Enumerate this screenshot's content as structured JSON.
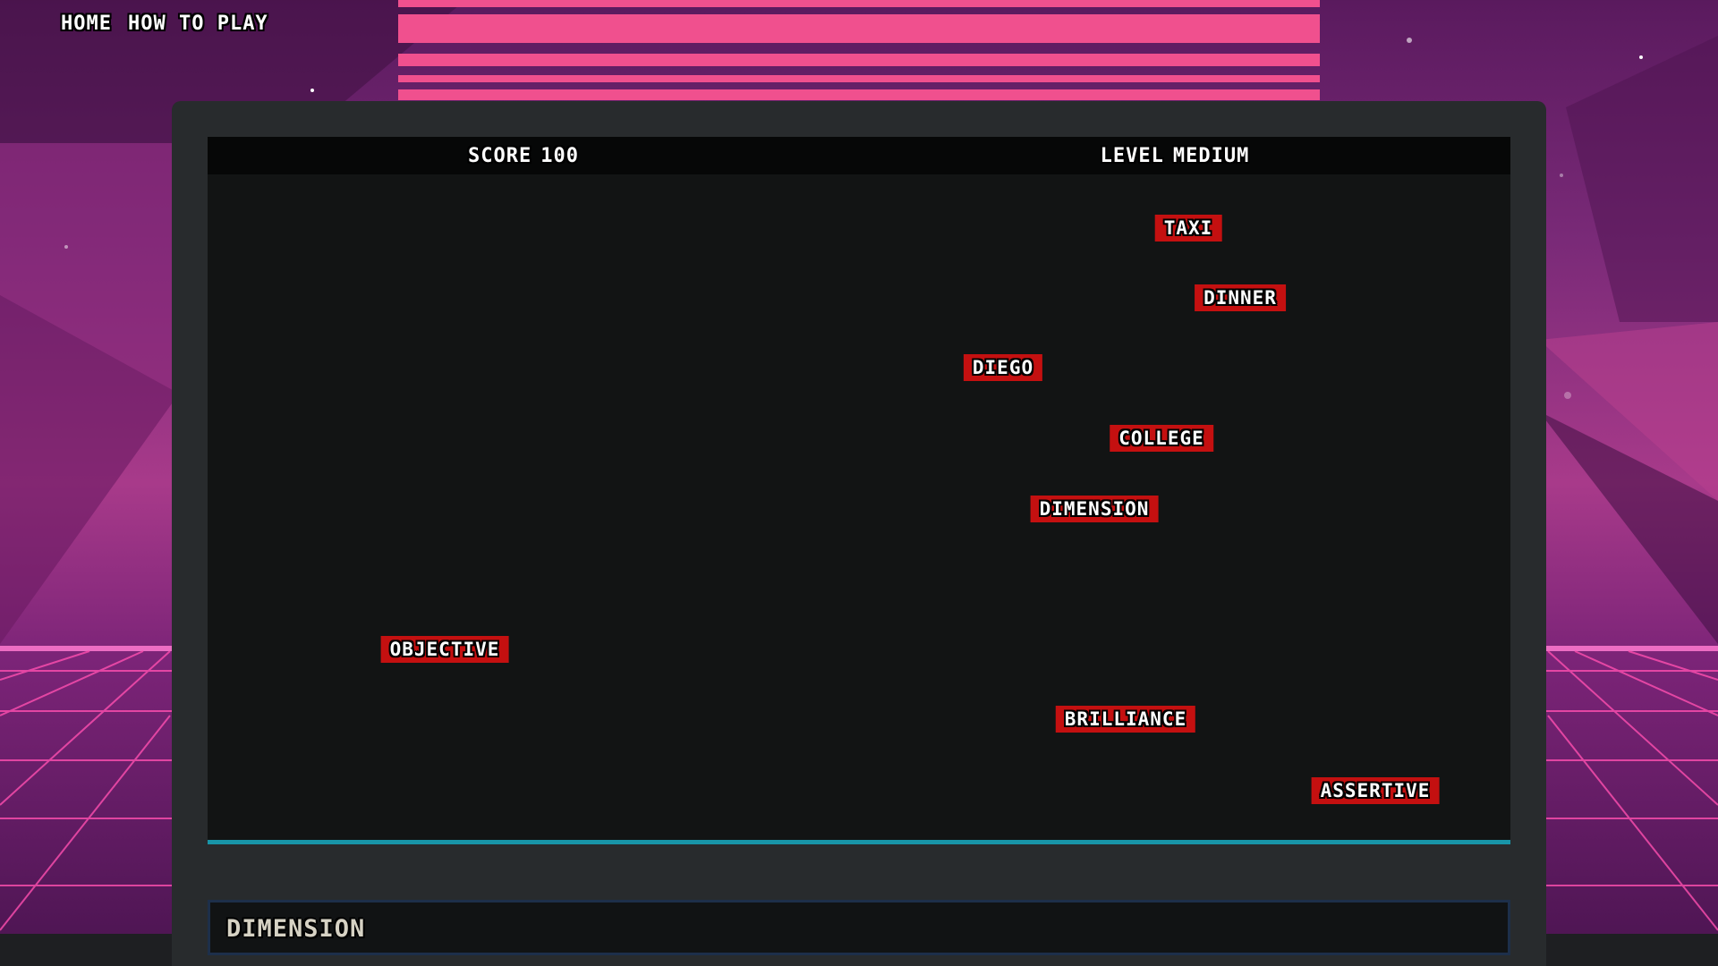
{
  "nav": {
    "home_label": "HOME",
    "how_to_play_label": "HOW TO PLAY"
  },
  "hud": {
    "score_label": "SCORE",
    "score_value": "100",
    "level_label": "LEVEL",
    "level_value": "MEDIUM"
  },
  "words": [
    "TAXI",
    "DINNER",
    "DIEGO",
    "COLLEGE",
    "DIMENSION",
    "OBJECTIVE",
    "BRILLIANCE",
    "ASSERTIVE"
  ],
  "input": {
    "typed_value": "DIMENSION"
  },
  "colors": {
    "word_background": "#c41010",
    "danger_line": "#1895a8",
    "sun": "#f0508e"
  }
}
